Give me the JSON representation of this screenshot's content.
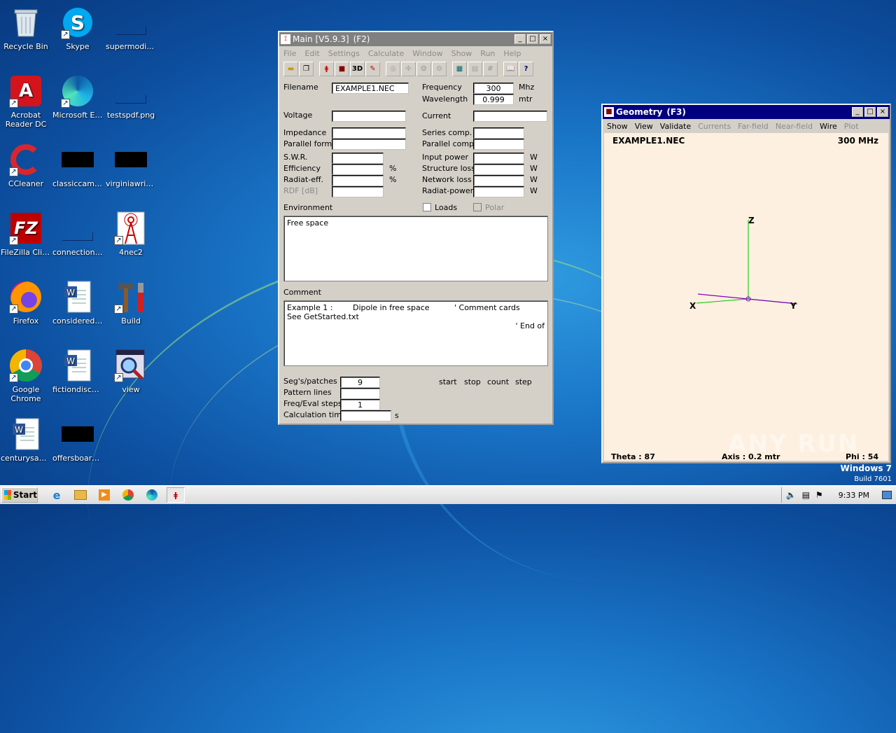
{
  "desktop": {
    "icons": [
      {
        "label": "Recycle Bin",
        "icon": "recycle-bin-icon"
      },
      {
        "label": "Skype",
        "icon": "skype-icon"
      },
      {
        "label": "supermodifi...",
        "icon": "file-icon"
      },
      {
        "label": "Acrobat Reader DC",
        "icon": "acrobat-icon"
      },
      {
        "label": "Microsoft Edge",
        "icon": "edge-icon"
      },
      {
        "label": "testspdf.png",
        "icon": "image-file-icon"
      },
      {
        "label": "CCleaner",
        "icon": "ccleaner-icon"
      },
      {
        "label": "classiccame...",
        "icon": "file-icon"
      },
      {
        "label": "virginiawrite...",
        "icon": "file-icon"
      },
      {
        "label": "FileZilla Client",
        "icon": "filezilla-icon"
      },
      {
        "label": "connectionc...",
        "icon": "file-icon"
      },
      {
        "label": "4nec2",
        "icon": "antenna-icon"
      },
      {
        "label": "Firefox",
        "icon": "firefox-icon"
      },
      {
        "label": "consideredv...",
        "icon": "word-doc-icon"
      },
      {
        "label": "Build",
        "icon": "tools-icon"
      },
      {
        "label": "Google Chrome",
        "icon": "chrome-icon"
      },
      {
        "label": "fictiondiscus...",
        "icon": "word-doc-icon"
      },
      {
        "label": "view",
        "icon": "magnifier-icon"
      },
      {
        "label": "centurysaw...",
        "icon": "word-doc-icon"
      },
      {
        "label": "offersboard...",
        "icon": "file-icon"
      }
    ],
    "watermark_os": "Windows 7",
    "watermark_build": "Build 7601",
    "watermark_brand": "ANY RUN"
  },
  "main_window": {
    "title": "Main [V5.9.3]",
    "shortcut": "(F2)",
    "menu": [
      "File",
      "Edit",
      "Settings",
      "Calculate",
      "Window",
      "Show",
      "Run",
      "Help"
    ],
    "toolbar_3d": "3D",
    "filename_label": "Filename",
    "filename_value": "EXAMPLE1.NEC",
    "frequency_label": "Frequency",
    "frequency_value": "300",
    "frequency_unit": "Mhz",
    "wavelength_label": "Wavelength",
    "wavelength_value": "0.999",
    "wavelength_unit": "mtr",
    "voltage_label": "Voltage",
    "current_label": "Current",
    "impedance_label": "Impedance",
    "series_label": "Series comp.",
    "parallel_form_label": "Parallel form",
    "parallel_comp_label": "Parallel comp.",
    "swr_label": "S.W.R.",
    "input_power_label": "Input power",
    "efficiency_label": "Efficiency",
    "structure_loss_label": "Structure loss",
    "radiat_eff_label": "Radiat-eff.",
    "network_loss_label": "Network loss",
    "rdf_label": "RDF [dB]",
    "radiat_power_label": "Radiat-power",
    "pct": "%",
    "watt": "W",
    "environment_label": "Environment",
    "loads_label": "Loads",
    "polar_label": "Polar",
    "environment_text": "Free space",
    "comment_label": "Comment",
    "comment_line1_a": "Example 1 :",
    "comment_line1_b": "Dipole in free space",
    "comment_line1_c": "' Comment cards",
    "comment_line2": "See GetStarted.txt",
    "comment_line3": "' End of",
    "segs_label": "Seg's/patches",
    "segs_value": "9",
    "pattern_label": "Pattern lines",
    "freq_steps_label": "Freq/Eval steps",
    "freq_steps_value": "1",
    "calc_time_label": "Calculation time",
    "calc_time_unit": "s",
    "col_start": "start",
    "col_stop": "stop",
    "col_count": "count",
    "col_step": "step"
  },
  "geometry_window": {
    "title": "Geometry",
    "shortcut": "(F3)",
    "menu": [
      "Show",
      "View",
      "Validate",
      "Currents",
      "Far-field",
      "Near-field",
      "Wire",
      "Plot"
    ],
    "filename": "EXAMPLE1.NEC",
    "freq": "300 MHz",
    "axis_z": "Z",
    "axis_x": "X",
    "axis_y": "Y",
    "theta": "Theta : 87",
    "axis_info": "Axis : 0.2 mtr",
    "phi": "Phi : 54",
    "bg_color": "#fdf0e0"
  },
  "taskbar": {
    "start_label": "Start",
    "clock": "9:33 PM",
    "apps": [
      "ie-icon",
      "explorer-icon",
      "media-player-icon",
      "chrome-icon",
      "edge-icon",
      "4nec2-icon"
    ]
  }
}
